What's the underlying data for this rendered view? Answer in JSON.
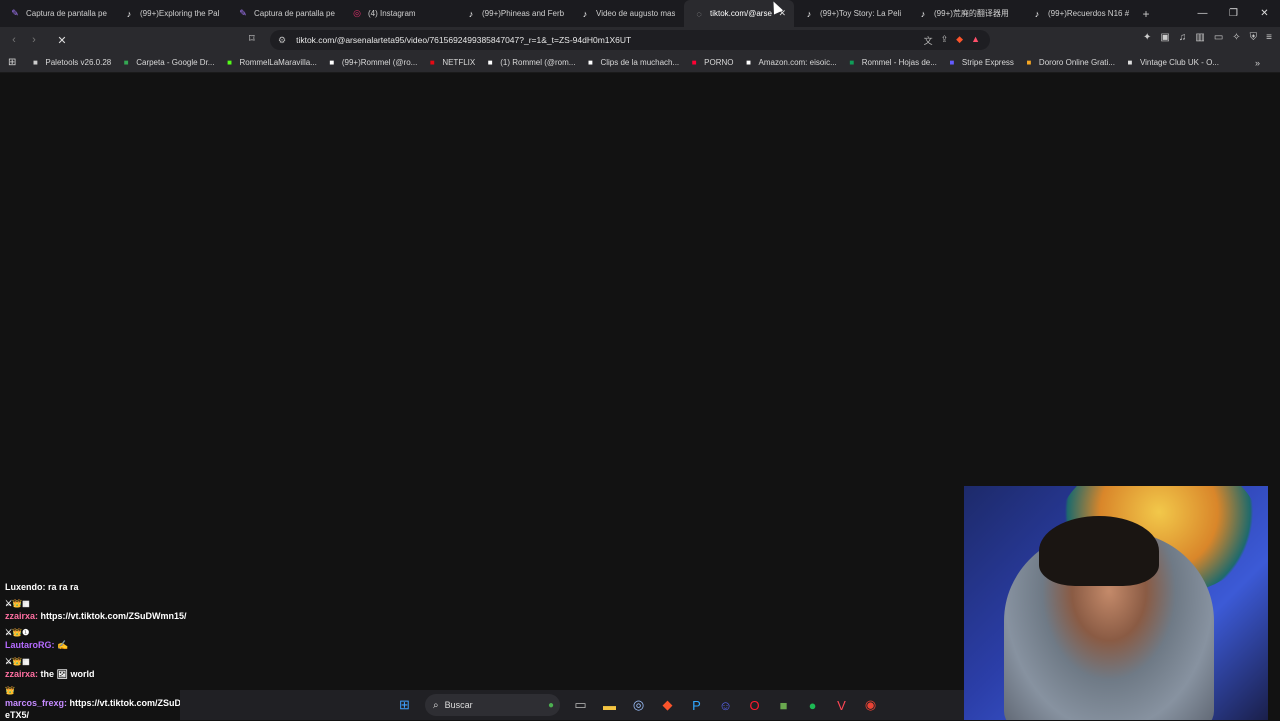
{
  "browser": {
    "tabs": [
      {
        "label": "Captura de pantalla pe",
        "icon": "pen-icon",
        "color": "#a87bff"
      },
      {
        "label": "(99+)Exploring the Pal",
        "icon": "tiktok-icon",
        "color": "#ffffff"
      },
      {
        "label": "Captura de pantalla pe",
        "icon": "pen-icon",
        "color": "#a87bff"
      },
      {
        "label": "(4) Instagram",
        "icon": "instagram-icon",
        "color": "#e1306c"
      },
      {
        "label": "(99+)Phineas and Ferb",
        "icon": "tiktok-icon",
        "color": "#ffffff"
      },
      {
        "label": "Video de augusto mas",
        "icon": "tiktok-icon",
        "color": "#ffffff"
      },
      {
        "label": "tiktok.com/@arse",
        "icon": "loading-globe-icon",
        "color": "#bbbbbb",
        "active": true
      },
      {
        "label": "(99+)Toy Story: La Peli",
        "icon": "tiktok-icon",
        "color": "#ffffff"
      },
      {
        "label": "(99+)荒廃的翻译器用",
        "icon": "tiktok-icon",
        "color": "#ffffff"
      },
      {
        "label": "(99+)Recuerdos N16 #",
        "icon": "tiktok-icon",
        "color": "#ffffff"
      }
    ],
    "url": "tiktok.com/@arsenalarteta95/video/7615692499385847047?_r=1&_t=ZS-94dH0m1X6UT",
    "bookmarks": [
      {
        "label": "Paletools v26.0.28",
        "icon": "globe-icon",
        "color": "#cccccc"
      },
      {
        "label": "Carpeta - Google Dr...",
        "icon": "drive-icon",
        "color": "#34a853"
      },
      {
        "label": "RommelLaMaravilla...",
        "icon": "kick-icon",
        "color": "#53fc18"
      },
      {
        "label": "(99+)Rommel (@ro...",
        "icon": "tiktok-icon",
        "color": "#ffffff"
      },
      {
        "label": "NETFLIX",
        "icon": "netflix-icon",
        "color": "#e50914"
      },
      {
        "label": "(1) Rommel (@rom...",
        "icon": "x-icon",
        "color": "#ffffff"
      },
      {
        "label": "Clips de la muchach...",
        "icon": "notion-icon",
        "color": "#ffffff"
      },
      {
        "label": "PORNO",
        "icon": "youtube-icon",
        "color": "#ff0033"
      },
      {
        "label": "Amazon.com: eisoic...",
        "icon": "amazon-icon",
        "color": "#ffffff"
      },
      {
        "label": "Rommel - Hojas de...",
        "icon": "sheets-icon",
        "color": "#0f9d58"
      },
      {
        "label": "Stripe Express",
        "icon": "stripe-icon",
        "color": "#635bff"
      },
      {
        "label": "Dororo Online Grati...",
        "icon": "animeflv-icon",
        "color": "#f5a623"
      },
      {
        "label": "Vintage Club UK - O...",
        "icon": "shop-icon",
        "color": "#dddddd"
      }
    ]
  },
  "chat": {
    "messages": [
      {
        "badges": "",
        "user": "Luxendo:",
        "text": "ra ra ra",
        "user_class": "u-lux"
      },
      {
        "badges": "⚔👑▦",
        "user": "zzairxa:",
        "text": "https://vt.tiktok.com/ZSuDWmn15/",
        "user_class": "u-zz"
      },
      {
        "badges": "⚔👑❶",
        "user": "LautaroRG:",
        "text": "✍",
        "user_class": "u-lau"
      },
      {
        "badges": "⚔👑▦",
        "user": "zzairxa:",
        "text": "the 🖼 world",
        "user_class": "u-zz"
      },
      {
        "badges": "👑",
        "user": "marcos_frexg:",
        "text": "https://vt.tiktok.com/ZSuDWeTX5/",
        "user_class": "u-mar"
      }
    ]
  },
  "taskbar": {
    "search_placeholder": "Buscar",
    "apps": [
      "file-explorer-icon",
      "folder-icon",
      "steam-icon",
      "brave-icon",
      "photoshop-icon",
      "discord-icon",
      "opera-icon",
      "minecraft-icon",
      "spotify-icon",
      "valorant-icon",
      "chrome-icon"
    ]
  }
}
